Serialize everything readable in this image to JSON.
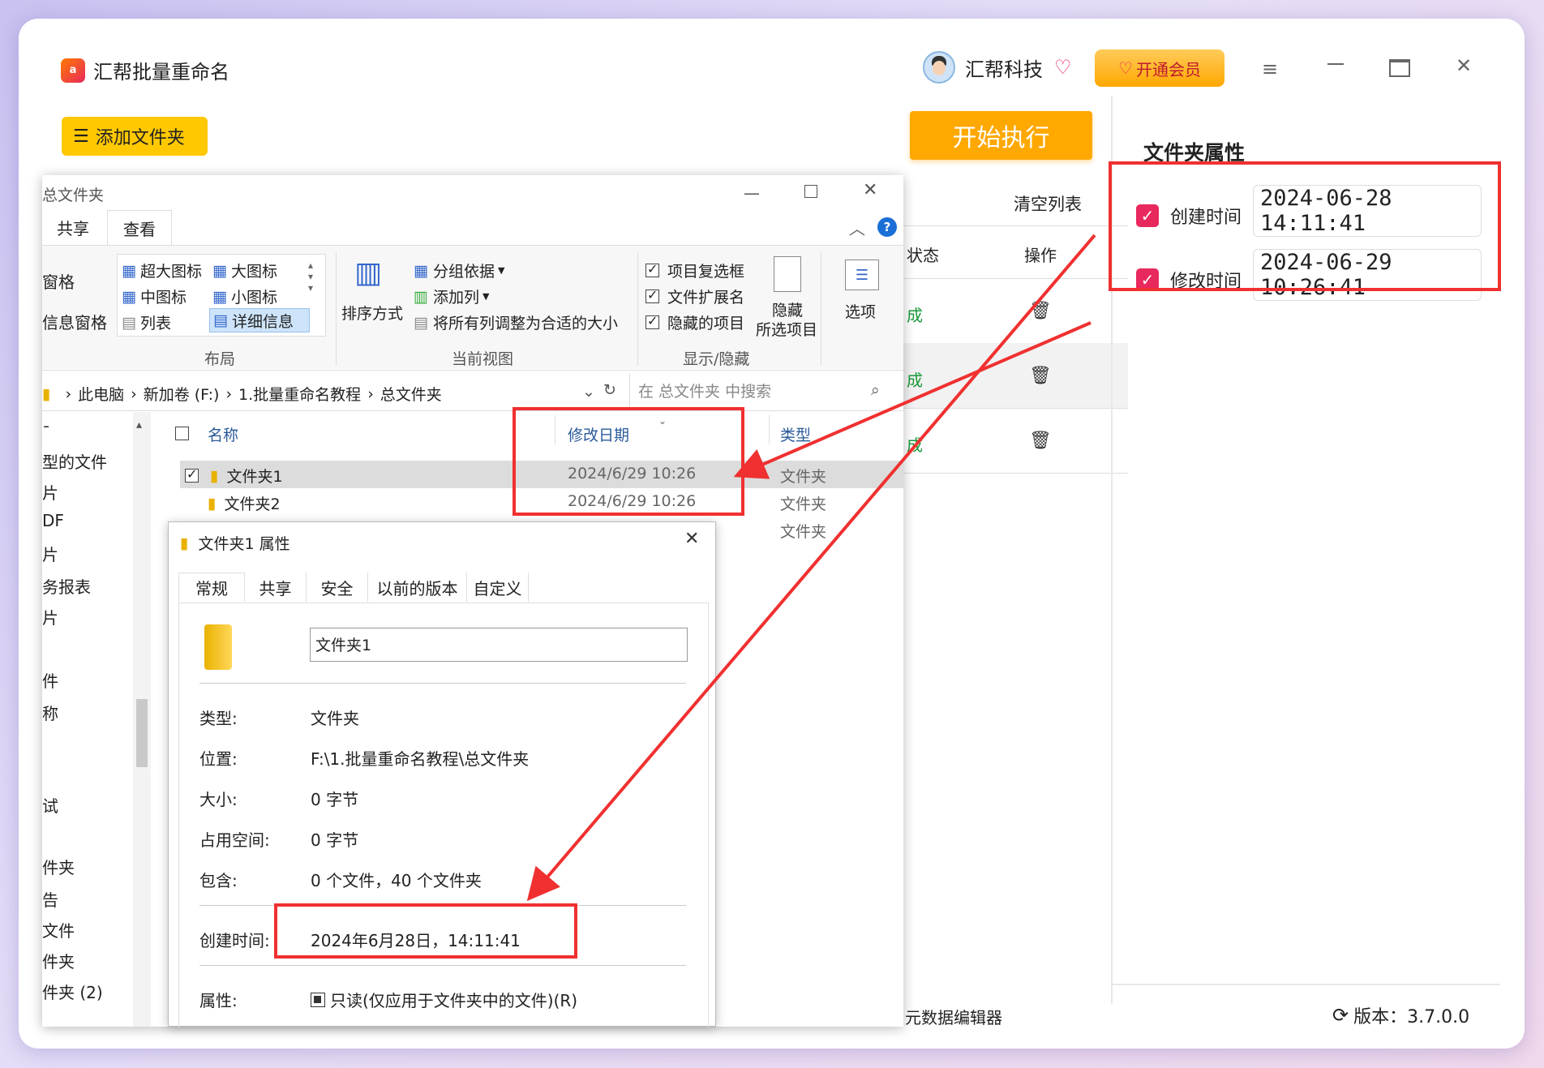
{
  "app": {
    "title": "汇帮批量重命名",
    "user": "汇帮科技",
    "vip_button": "开通会员",
    "add_folder": "添加文件夹",
    "start": "开始执行",
    "clear_list": "清空列表",
    "col_status": "状态",
    "col_action": "操作",
    "rows_status": [
      "成",
      "成",
      "成"
    ],
    "footer_left": "元数据编辑器",
    "version": "版本：3.7.0.0",
    "accent": "#ffa800",
    "brand_red": "#e8295d"
  },
  "props_panel": {
    "title": "文件夹属性",
    "created_label": "创建时间",
    "created_value": "2024-06-28 14:11:41",
    "modified_label": "修改时间",
    "modified_value": "2024-06-29 10:26:41"
  },
  "explorer": {
    "title": "总文件夹",
    "tabs": [
      "共享",
      "查看"
    ],
    "layout_items": [
      "超大图标",
      "大图标",
      "中图标",
      "小图标",
      "列表",
      "详细信息"
    ],
    "left_items": [
      "窗格",
      "信息窗格"
    ],
    "sort": "排序方式",
    "group_by": "分组依据",
    "add_col": "添加列",
    "fit_cols": "将所有列调整为合适的大小",
    "cb_items": [
      "项目复选框",
      "文件扩展名",
      "隐藏的项目"
    ],
    "hide_sel_1": "隐藏",
    "hide_sel_2": "所选项目",
    "options": "选项",
    "group_layout": "布局",
    "group_view": "当前视图",
    "group_show": "显示/隐藏",
    "breadcrumb": [
      "此电脑",
      "新加卷 (F:)",
      "1.批量重命名教程",
      "总文件夹"
    ],
    "search_placeholder": "在 总文件夹 中搜索",
    "col_name": "名称",
    "col_date": "修改日期",
    "col_type": "类型",
    "files": [
      {
        "name": "文件夹1",
        "date": "2024/6/29 10:26",
        "type": "文件夹"
      },
      {
        "name": "文件夹2",
        "date": "2024/6/29 10:26",
        "type": "文件夹"
      },
      {
        "name": "",
        "date": "",
        "type": "文件夹"
      }
    ],
    "nav": [
      "片",
      "型的文件",
      "片",
      "DF",
      "片",
      "务报表",
      "片",
      "",
      "件",
      "称",
      "",
      "",
      "试",
      "",
      "件夹",
      "告",
      "文件",
      "件夹",
      "件夹 (2)"
    ]
  },
  "dialog": {
    "title": "文件夹1 属性",
    "tabs": [
      "常规",
      "共享",
      "安全",
      "以前的版本",
      "自定义"
    ],
    "name_value": "文件夹1",
    "type_label": "类型:",
    "type_value": "文件夹",
    "loc_label": "位置:",
    "loc_value": "F:\\1.批量重命名教程\\总文件夹",
    "size_label": "大小:",
    "size_value": "0 字节",
    "disk_label": "占用空间:",
    "disk_value": "0 字节",
    "contains_label": "包含:",
    "contains_value": "0 个文件，40 个文件夹",
    "created_label": "创建时间:",
    "created_value": "2024年6月28日，14:11:41",
    "attr_label": "属性:",
    "attr_value": "只读(仅应用于文件夹中的文件)(R)"
  }
}
